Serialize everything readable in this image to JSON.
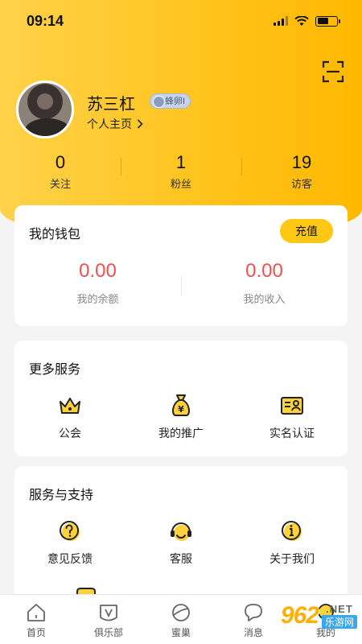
{
  "status_bar": {
    "time": "09:14"
  },
  "profile": {
    "username": "苏三杠",
    "level_badge": "蜂卵I",
    "profile_link": "个人主页"
  },
  "stats": [
    {
      "value": "0",
      "label": "关注"
    },
    {
      "value": "1",
      "label": "粉丝"
    },
    {
      "value": "19",
      "label": "访客"
    }
  ],
  "wallet": {
    "title": "我的钱包",
    "recharge_label": "充值",
    "balance": {
      "value": "0.00",
      "label": "我的余额"
    },
    "income": {
      "value": "0.00",
      "label": "我的收入"
    }
  },
  "more_services": {
    "title": "更多服务",
    "items": [
      {
        "label": "公会",
        "icon": "crown-icon"
      },
      {
        "label": "我的推广",
        "icon": "money-bag-icon"
      },
      {
        "label": "实名认证",
        "icon": "id-card-icon"
      }
    ]
  },
  "support": {
    "title": "服务与支持",
    "items": [
      {
        "label": "意见反馈",
        "icon": "question-icon"
      },
      {
        "label": "客服",
        "icon": "headset-icon"
      },
      {
        "label": "关于我们",
        "icon": "info-icon"
      }
    ]
  },
  "tabbar": [
    {
      "label": "首页",
      "icon": "home-icon"
    },
    {
      "label": "俱乐部",
      "icon": "club-icon"
    },
    {
      "label": "蜜巢",
      "icon": "planet-icon"
    },
    {
      "label": "消息",
      "icon": "message-icon"
    },
    {
      "label": "我的",
      "icon": "profile-icon"
    }
  ],
  "watermark": {
    "logo": "962",
    "net": ".NET",
    "name": "乐游网"
  },
  "colors": {
    "accent": "#ffc815",
    "money": "#f05050",
    "header": "#ffc21a"
  }
}
